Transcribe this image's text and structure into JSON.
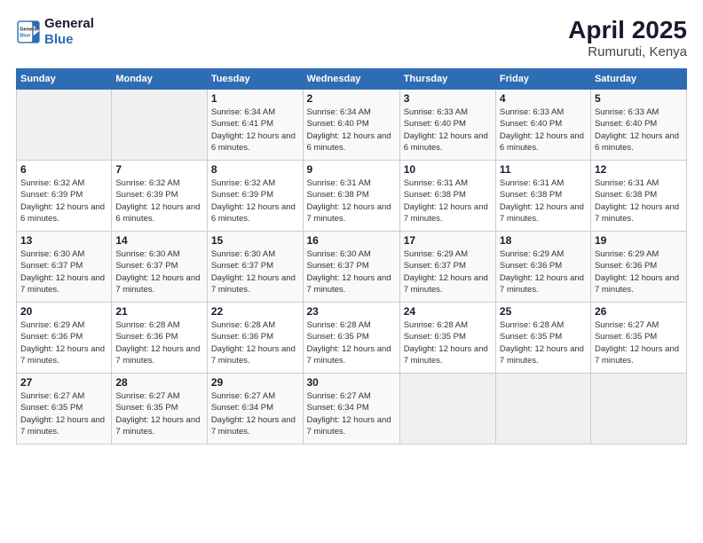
{
  "logo": {
    "line1": "General",
    "line2": "Blue"
  },
  "title": "April 2025",
  "subtitle": "Rumuruti, Kenya",
  "days_of_week": [
    "Sunday",
    "Monday",
    "Tuesday",
    "Wednesday",
    "Thursday",
    "Friday",
    "Saturday"
  ],
  "weeks": [
    [
      {
        "day": "",
        "info": ""
      },
      {
        "day": "",
        "info": ""
      },
      {
        "day": "1",
        "info": "Sunrise: 6:34 AM\nSunset: 6:41 PM\nDaylight: 12 hours and 6 minutes."
      },
      {
        "day": "2",
        "info": "Sunrise: 6:34 AM\nSunset: 6:40 PM\nDaylight: 12 hours and 6 minutes."
      },
      {
        "day": "3",
        "info": "Sunrise: 6:33 AM\nSunset: 6:40 PM\nDaylight: 12 hours and 6 minutes."
      },
      {
        "day": "4",
        "info": "Sunrise: 6:33 AM\nSunset: 6:40 PM\nDaylight: 12 hours and 6 minutes."
      },
      {
        "day": "5",
        "info": "Sunrise: 6:33 AM\nSunset: 6:40 PM\nDaylight: 12 hours and 6 minutes."
      }
    ],
    [
      {
        "day": "6",
        "info": "Sunrise: 6:32 AM\nSunset: 6:39 PM\nDaylight: 12 hours and 6 minutes."
      },
      {
        "day": "7",
        "info": "Sunrise: 6:32 AM\nSunset: 6:39 PM\nDaylight: 12 hours and 6 minutes."
      },
      {
        "day": "8",
        "info": "Sunrise: 6:32 AM\nSunset: 6:39 PM\nDaylight: 12 hours and 6 minutes."
      },
      {
        "day": "9",
        "info": "Sunrise: 6:31 AM\nSunset: 6:38 PM\nDaylight: 12 hours and 7 minutes."
      },
      {
        "day": "10",
        "info": "Sunrise: 6:31 AM\nSunset: 6:38 PM\nDaylight: 12 hours and 7 minutes."
      },
      {
        "day": "11",
        "info": "Sunrise: 6:31 AM\nSunset: 6:38 PM\nDaylight: 12 hours and 7 minutes."
      },
      {
        "day": "12",
        "info": "Sunrise: 6:31 AM\nSunset: 6:38 PM\nDaylight: 12 hours and 7 minutes."
      }
    ],
    [
      {
        "day": "13",
        "info": "Sunrise: 6:30 AM\nSunset: 6:37 PM\nDaylight: 12 hours and 7 minutes."
      },
      {
        "day": "14",
        "info": "Sunrise: 6:30 AM\nSunset: 6:37 PM\nDaylight: 12 hours and 7 minutes."
      },
      {
        "day": "15",
        "info": "Sunrise: 6:30 AM\nSunset: 6:37 PM\nDaylight: 12 hours and 7 minutes."
      },
      {
        "day": "16",
        "info": "Sunrise: 6:30 AM\nSunset: 6:37 PM\nDaylight: 12 hours and 7 minutes."
      },
      {
        "day": "17",
        "info": "Sunrise: 6:29 AM\nSunset: 6:37 PM\nDaylight: 12 hours and 7 minutes."
      },
      {
        "day": "18",
        "info": "Sunrise: 6:29 AM\nSunset: 6:36 PM\nDaylight: 12 hours and 7 minutes."
      },
      {
        "day": "19",
        "info": "Sunrise: 6:29 AM\nSunset: 6:36 PM\nDaylight: 12 hours and 7 minutes."
      }
    ],
    [
      {
        "day": "20",
        "info": "Sunrise: 6:29 AM\nSunset: 6:36 PM\nDaylight: 12 hours and 7 minutes."
      },
      {
        "day": "21",
        "info": "Sunrise: 6:28 AM\nSunset: 6:36 PM\nDaylight: 12 hours and 7 minutes."
      },
      {
        "day": "22",
        "info": "Sunrise: 6:28 AM\nSunset: 6:36 PM\nDaylight: 12 hours and 7 minutes."
      },
      {
        "day": "23",
        "info": "Sunrise: 6:28 AM\nSunset: 6:35 PM\nDaylight: 12 hours and 7 minutes."
      },
      {
        "day": "24",
        "info": "Sunrise: 6:28 AM\nSunset: 6:35 PM\nDaylight: 12 hours and 7 minutes."
      },
      {
        "day": "25",
        "info": "Sunrise: 6:28 AM\nSunset: 6:35 PM\nDaylight: 12 hours and 7 minutes."
      },
      {
        "day": "26",
        "info": "Sunrise: 6:27 AM\nSunset: 6:35 PM\nDaylight: 12 hours and 7 minutes."
      }
    ],
    [
      {
        "day": "27",
        "info": "Sunrise: 6:27 AM\nSunset: 6:35 PM\nDaylight: 12 hours and 7 minutes."
      },
      {
        "day": "28",
        "info": "Sunrise: 6:27 AM\nSunset: 6:35 PM\nDaylight: 12 hours and 7 minutes."
      },
      {
        "day": "29",
        "info": "Sunrise: 6:27 AM\nSunset: 6:34 PM\nDaylight: 12 hours and 7 minutes."
      },
      {
        "day": "30",
        "info": "Sunrise: 6:27 AM\nSunset: 6:34 PM\nDaylight: 12 hours and 7 minutes."
      },
      {
        "day": "",
        "info": ""
      },
      {
        "day": "",
        "info": ""
      },
      {
        "day": "",
        "info": ""
      }
    ]
  ]
}
